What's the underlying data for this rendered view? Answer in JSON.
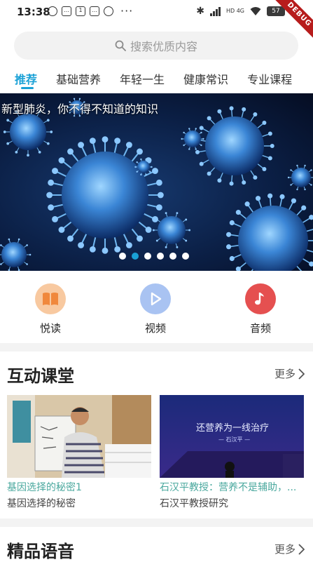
{
  "status_bar": {
    "time": "13:38",
    "battery": "57",
    "network": "HD 4G",
    "debug_label": "DEBUG"
  },
  "search": {
    "placeholder": "搜索优质内容"
  },
  "tabs": [
    {
      "label": "推荐"
    },
    {
      "label": "基础营养"
    },
    {
      "label": "年轻一生"
    },
    {
      "label": "健康常识"
    },
    {
      "label": "专业课程"
    }
  ],
  "banner": {
    "caption": "新型肺炎，你不得不知道的知识",
    "slide_count": 6,
    "active_slide": 2
  },
  "quick_actions": [
    {
      "label": "悦读",
      "icon": "book-icon",
      "color": "#f6b27a"
    },
    {
      "label": "视频",
      "icon": "play-icon",
      "color": "#7ea6ea"
    },
    {
      "label": "音频",
      "icon": "music-note-icon",
      "color": "#e65050"
    }
  ],
  "sections": {
    "interactive": {
      "title": "互动课堂",
      "more": "更多",
      "cards": [
        {
          "title": "基因选择的秘密1",
          "subtitle": "基因选择的秘密"
        },
        {
          "title": "石汉平教授：营养不是辅助，...",
          "subtitle": "石汉平教授研究",
          "image_text": "还营养为一线治疗",
          "image_subtext": "— 石汉平 —"
        }
      ]
    },
    "audio": {
      "title": "精品语音",
      "more": "更多"
    }
  },
  "colors": {
    "accent": "#1aa1d6",
    "card_title": "#4aa89e"
  }
}
